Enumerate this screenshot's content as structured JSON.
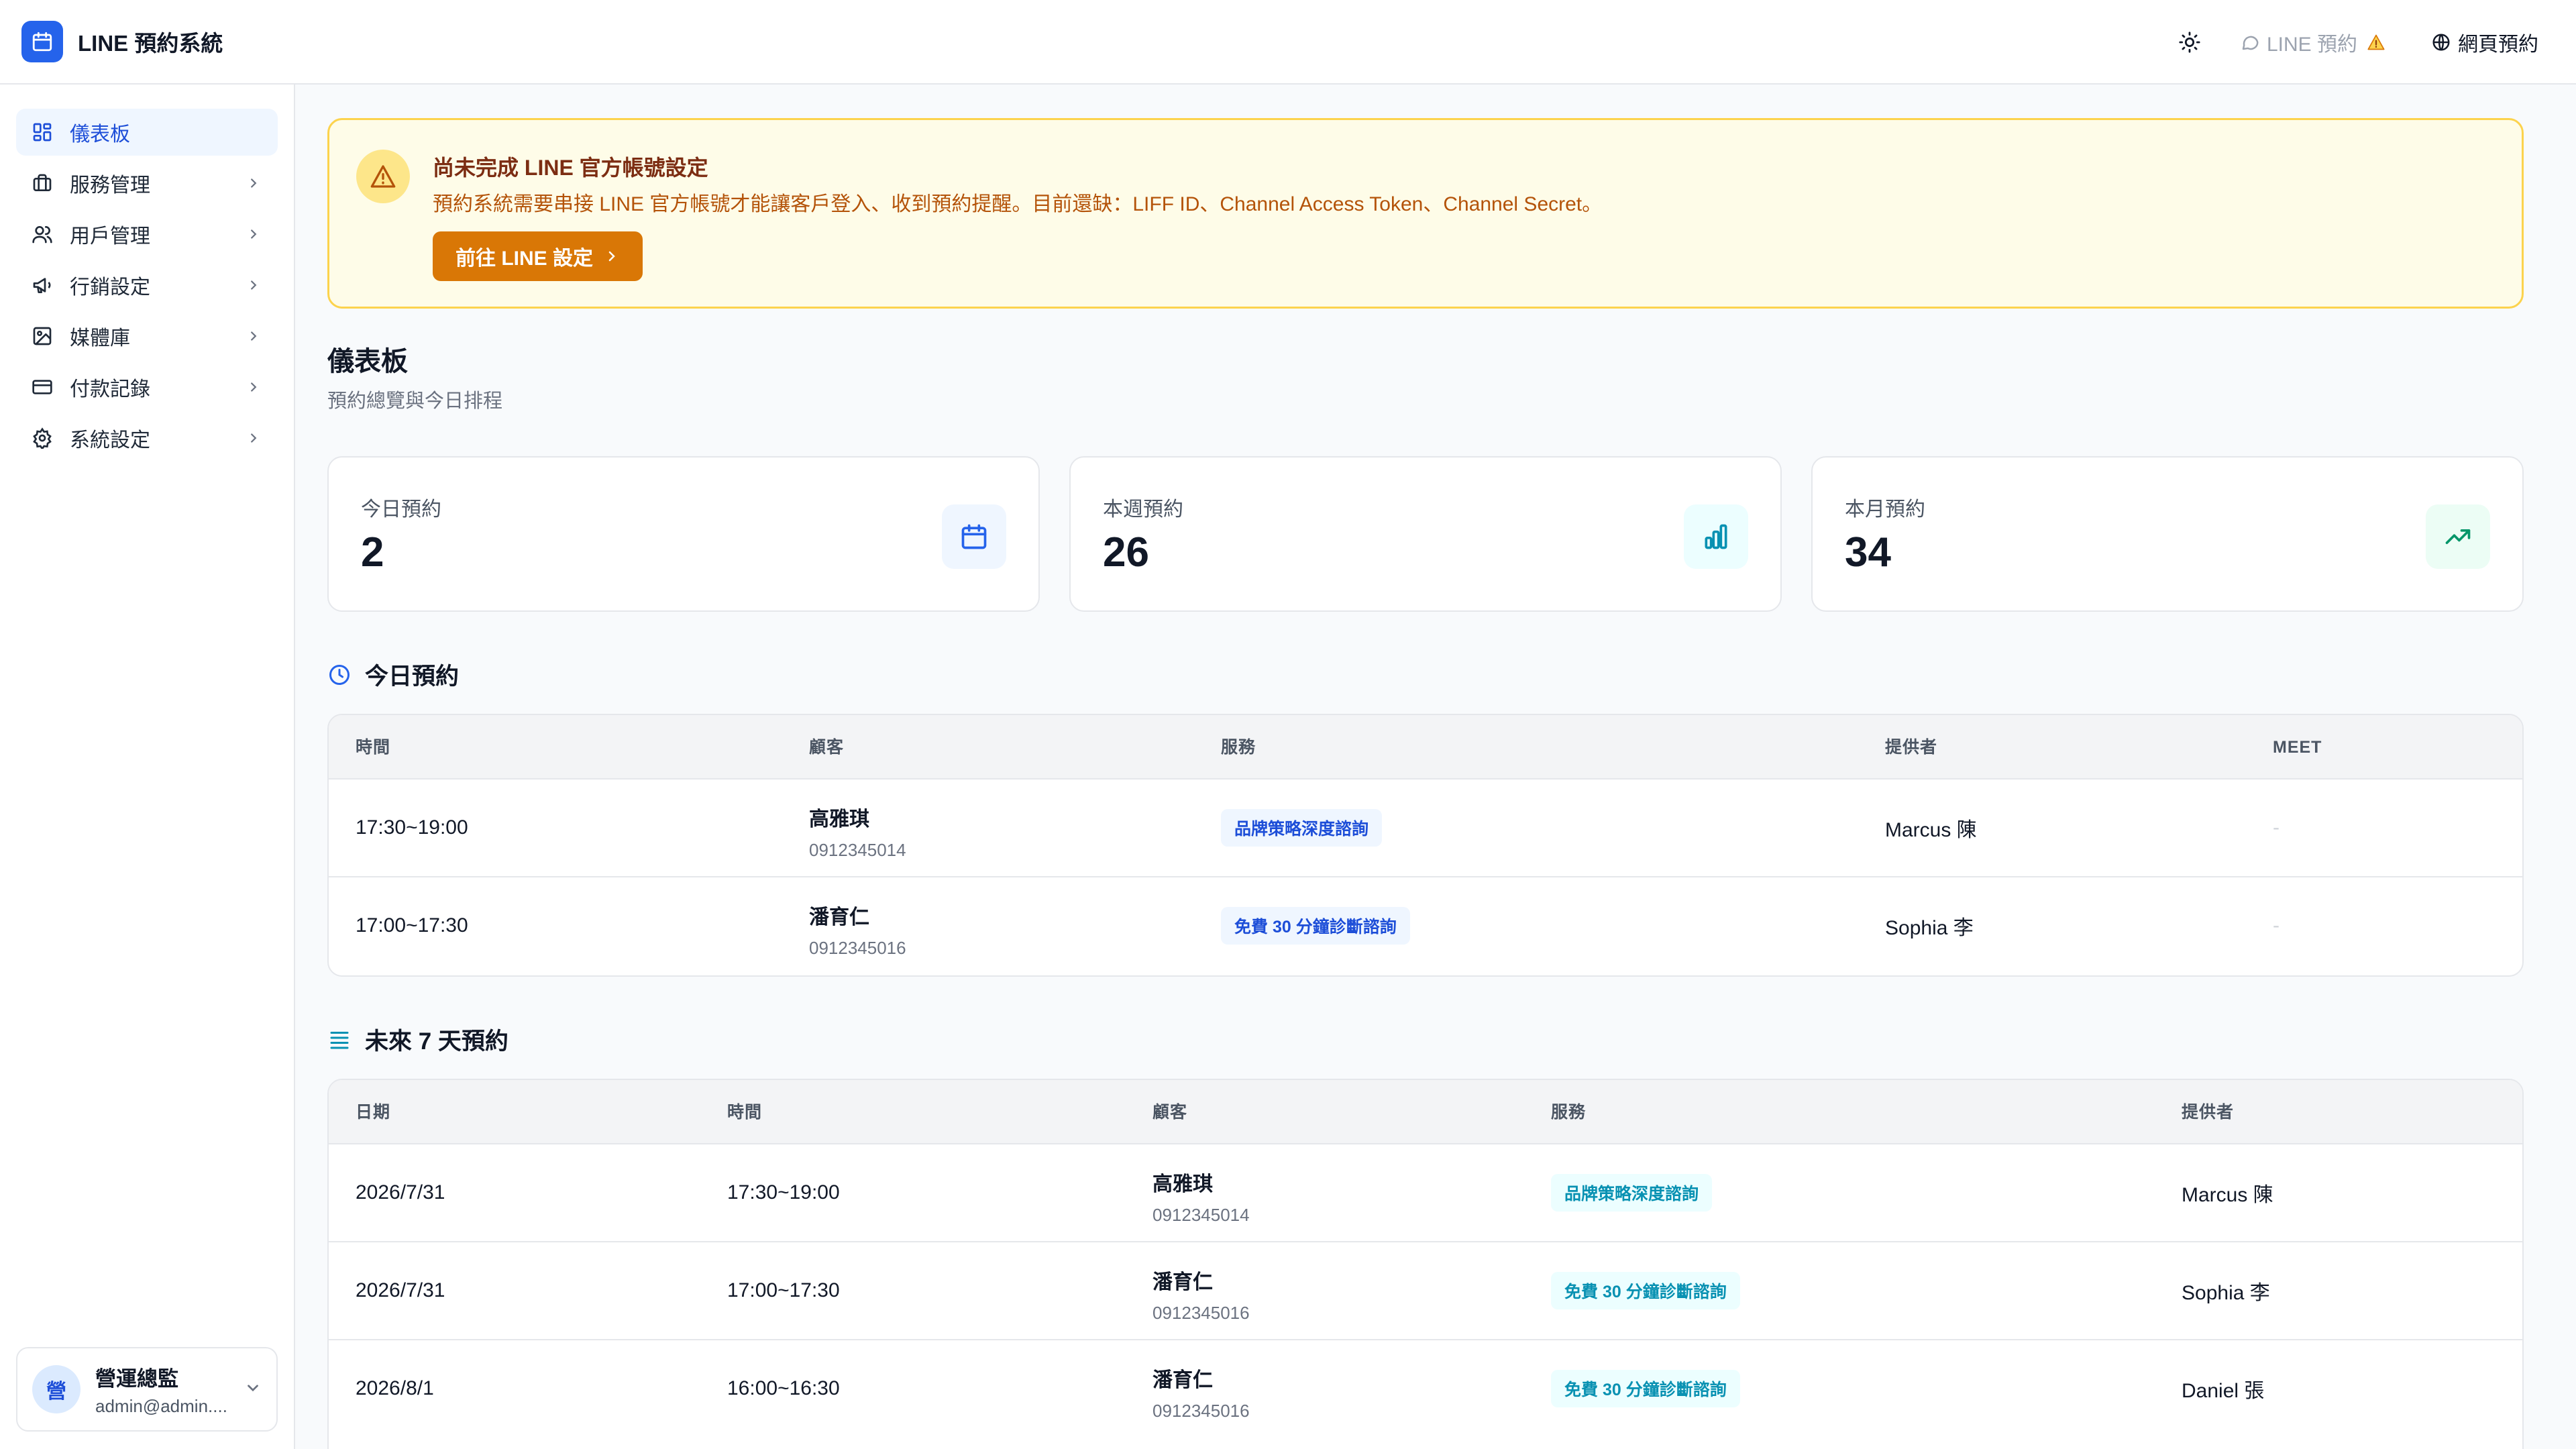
{
  "app": {
    "title": "LINE 預約系統"
  },
  "topbar": {
    "line_booking": "LINE 預約",
    "web_booking": "網頁預約",
    "theme_icon": "sun-icon"
  },
  "sidebar": {
    "items": [
      {
        "label": "儀表板",
        "icon": "dashboard-icon",
        "active": true
      },
      {
        "label": "服務管理",
        "icon": "briefcase-icon"
      },
      {
        "label": "用戶管理",
        "icon": "users-icon"
      },
      {
        "label": "行銷設定",
        "icon": "megaphone-icon"
      },
      {
        "label": "媒體庫",
        "icon": "image-icon"
      },
      {
        "label": "付款記錄",
        "icon": "credit-card-icon"
      },
      {
        "label": "系統設定",
        "icon": "gear-icon"
      }
    ],
    "user": {
      "avatar": "營",
      "name": "營運總監",
      "email": "admin@admin...."
    }
  },
  "alert": {
    "title": "尚未完成 LINE 官方帳號設定",
    "description": "預約系統需要串接 LINE 官方帳號才能讓客戶登入、收到預約提醒。目前還缺：LIFF ID、Channel Access Token、Channel Secret。",
    "button": "前往 LINE 設定"
  },
  "page": {
    "title": "儀表板",
    "subtitle": "預約總覽與今日排程"
  },
  "stats": [
    {
      "label": "今日預約",
      "value": "2",
      "icon": "calendar-icon",
      "color": "#2563eb",
      "bg": "#eff6ff"
    },
    {
      "label": "本週預約",
      "value": "26",
      "icon": "bar-chart-icon",
      "color": "#0891b2",
      "bg": "#ecfeff"
    },
    {
      "label": "本月預約",
      "value": "34",
      "icon": "trending-up-icon",
      "color": "#059669",
      "bg": "#ecfdf5"
    }
  ],
  "today": {
    "title": "今日預約",
    "headers": {
      "time": "時間",
      "customer": "顧客",
      "service": "服務",
      "provider": "提供者",
      "meet": "MEET"
    },
    "rows": [
      {
        "time": "17:30~19:00",
        "name": "高雅琪",
        "phone": "0912345014",
        "service": "品牌策略深度諮詢",
        "provider": "Marcus 陳",
        "meet": "-"
      },
      {
        "time": "17:00~17:30",
        "name": "潘育仁",
        "phone": "0912345016",
        "service": "免費 30 分鐘診斷諮詢",
        "provider": "Sophia 李",
        "meet": "-"
      }
    ]
  },
  "upcoming": {
    "title": "未來 7 天預約",
    "headers": {
      "date": "日期",
      "time": "時間",
      "customer": "顧客",
      "service": "服務",
      "provider": "提供者"
    },
    "rows": [
      {
        "date": "2026/7/31",
        "time": "17:30~19:00",
        "name": "高雅琪",
        "phone": "0912345014",
        "service": "品牌策略深度諮詢",
        "provider": "Marcus 陳"
      },
      {
        "date": "2026/7/31",
        "time": "17:00~17:30",
        "name": "潘育仁",
        "phone": "0912345016",
        "service": "免費 30 分鐘診斷諮詢",
        "provider": "Sophia 李"
      },
      {
        "date": "2026/8/1",
        "time": "16:00~16:30",
        "name": "潘育仁",
        "phone": "0912345016",
        "service": "免費 30 分鐘診斷諮詢",
        "provider": "Daniel 張"
      }
    ]
  },
  "colors": {
    "primary": "#2563eb",
    "warning": "#d97706",
    "teal": "#0891b2"
  }
}
